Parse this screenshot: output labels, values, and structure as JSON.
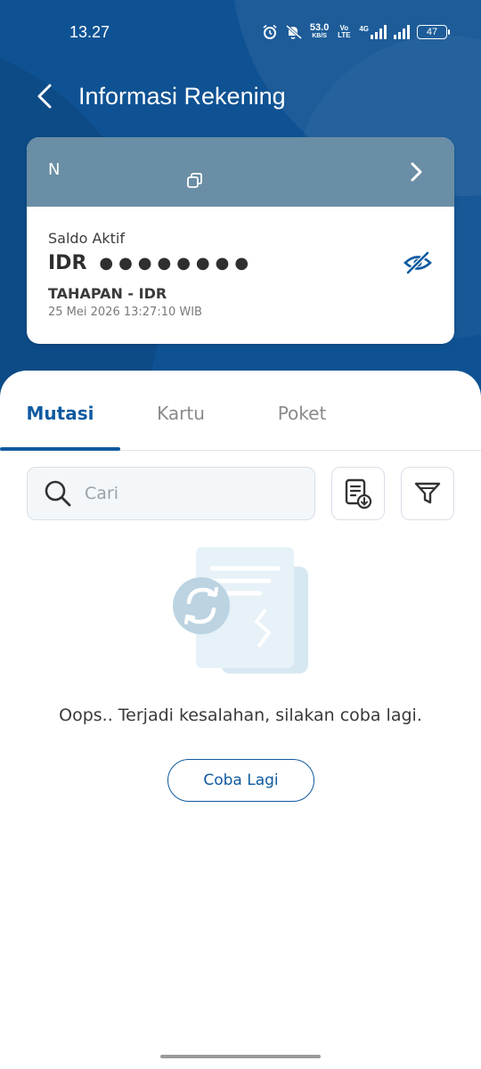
{
  "status_bar": {
    "time": "13.27",
    "network_speed": "53.0",
    "network_unit": "KB/S",
    "volte": "Vo LTE",
    "network_type": "4G",
    "battery": "47"
  },
  "app_bar": {
    "title": "Informasi Rekening",
    "back_icon": "chevron-left-icon"
  },
  "account_card": {
    "account_number": "N",
    "balance_label": "Saldo Aktif",
    "currency": "IDR",
    "balance_masked": "●●●●●●●●",
    "account_type": "TAHAPAN - IDR",
    "timestamp": "25 Mei 2026 13:27:10 WIB",
    "header_color": "#6a8ea5"
  },
  "tabs": [
    {
      "label": "Mutasi",
      "active": true
    },
    {
      "label": "Kartu",
      "active": false
    },
    {
      "label": "Poket",
      "active": false
    }
  ],
  "search": {
    "placeholder": "Cari",
    "value": ""
  },
  "empty_state": {
    "message": "Oops.. Terjadi kesalahan, silakan coba lagi.",
    "retry_label": "Coba Lagi"
  },
  "colors": {
    "header_bg": "#0f5293",
    "accent": "#0f5aa0"
  }
}
